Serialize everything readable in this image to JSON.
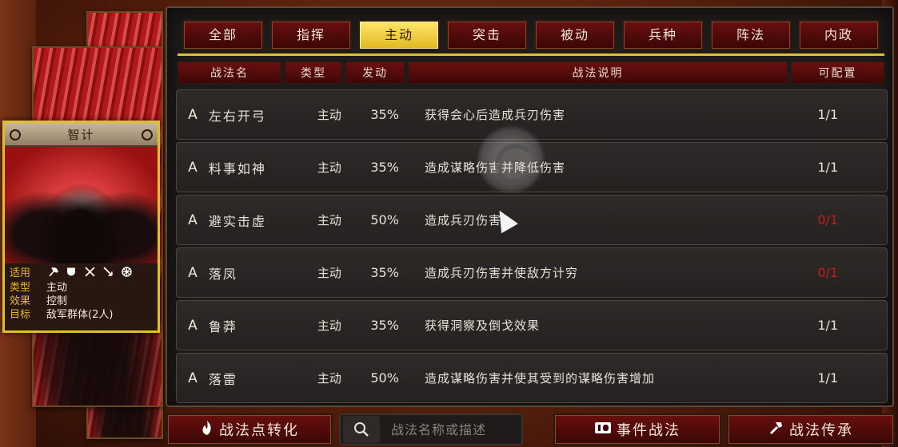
{
  "card": {
    "title": "智计",
    "stats": [
      {
        "key": "适用",
        "value": ""
      },
      {
        "key": "类型",
        "value": "主动"
      },
      {
        "key": "效果",
        "value": "控制"
      },
      {
        "key": "目标",
        "value": "敌军群体(2人)"
      }
    ],
    "unit_icons": [
      "axe-icon",
      "shield-icon",
      "crossed-swords-icon",
      "arrow-icon",
      "wheel-icon"
    ]
  },
  "tabs": [
    {
      "label": "全部",
      "active": false
    },
    {
      "label": "指挥",
      "active": false
    },
    {
      "label": "主动",
      "active": true
    },
    {
      "label": "突击",
      "active": false
    },
    {
      "label": "被动",
      "active": false
    },
    {
      "label": "兵种",
      "active": false
    },
    {
      "label": "阵法",
      "active": false
    },
    {
      "label": "内政",
      "active": false
    }
  ],
  "columns": {
    "name": "战法名",
    "type": "类型",
    "rate": "发动",
    "desc": "战法说明",
    "count": "可配置"
  },
  "tactics": [
    {
      "grade": "A",
      "name": "左右开弓",
      "type": "主动",
      "rate": "35%",
      "desc": "获得会心后造成兵刃伤害",
      "count": "1/1",
      "count_color": "normal"
    },
    {
      "grade": "A",
      "name": "料事如神",
      "type": "主动",
      "rate": "35%",
      "desc": "造成谋略伤害并降低伤害",
      "count": "1/1",
      "count_color": "normal"
    },
    {
      "grade": "A",
      "name": "避实击虚",
      "type": "主动",
      "rate": "50%",
      "desc": "造成兵刃伤害",
      "count": "0/1",
      "count_color": "red"
    },
    {
      "grade": "A",
      "name": "落凤",
      "type": "主动",
      "rate": "35%",
      "desc": "造成兵刃伤害并使敌方计穷",
      "count": "0/1",
      "count_color": "red"
    },
    {
      "grade": "A",
      "name": "鲁莽",
      "type": "主动",
      "rate": "35%",
      "desc": "获得洞察及倒戈效果",
      "count": "1/1",
      "count_color": "normal"
    },
    {
      "grade": "A",
      "name": "落雷",
      "type": "主动",
      "rate": "50%",
      "desc": "造成谋略伤害并使其受到的谋略伤害增加",
      "count": "1/1",
      "count_color": "normal"
    }
  ],
  "bottom": {
    "convert_label": "战法点转化",
    "search_placeholder": "战法名称或描述",
    "event_label": "事件战法",
    "inherit_label": "战法传承"
  },
  "colors": {
    "accent_gold": "#e0c02a",
    "tab_red": "#6a0f0f",
    "count_red": "#c81a1a"
  }
}
